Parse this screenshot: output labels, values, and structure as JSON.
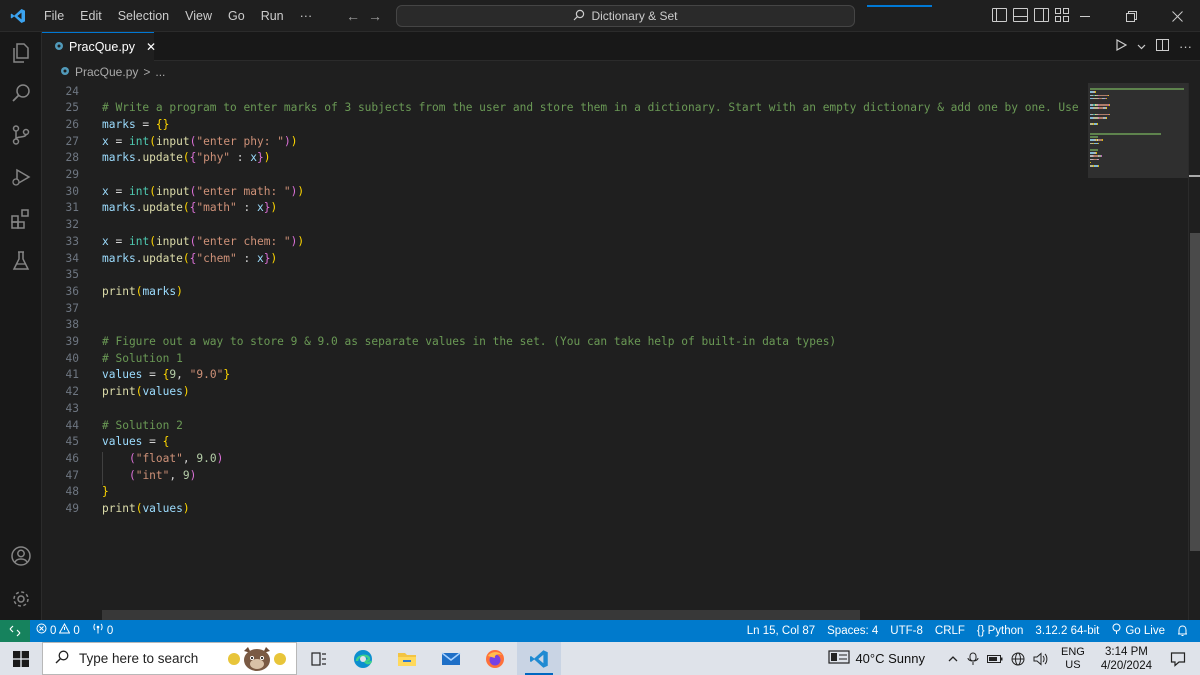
{
  "titlebar": {
    "menu": [
      "File",
      "Edit",
      "Selection",
      "View",
      "Go",
      "Run",
      "···"
    ],
    "command_center": "Dictionary & Set",
    "back_glyph": "←",
    "forward_glyph": "→"
  },
  "tab": {
    "filename": "PracQue.py",
    "close_glyph": "✕"
  },
  "breadcrumb": {
    "file": "PracQue.py",
    "separator": ">",
    "rest": "..."
  },
  "editor": {
    "lines": [
      {
        "n": "24",
        "tokens": []
      },
      {
        "n": "25",
        "tokens": [
          {
            "c": "c-com",
            "t": "# Write a program to enter marks of 3 subjects from the user and store them in a dictionary. Start with an empty dictionary & add one by one. Use"
          }
        ]
      },
      {
        "n": "26",
        "tokens": [
          {
            "c": "c-var",
            "t": "marks"
          },
          {
            "c": "c-op",
            "t": " = "
          },
          {
            "c": "c-br",
            "t": "{}"
          }
        ]
      },
      {
        "n": "27",
        "tokens": [
          {
            "c": "c-var",
            "t": "x"
          },
          {
            "c": "c-op",
            "t": " = "
          },
          {
            "c": "c-type",
            "t": "int"
          },
          {
            "c": "c-br",
            "t": "("
          },
          {
            "c": "c-fn",
            "t": "input"
          },
          {
            "c": "c-br2",
            "t": "("
          },
          {
            "c": "c-str",
            "t": "\"enter phy: \""
          },
          {
            "c": "c-br2",
            "t": ")"
          },
          {
            "c": "c-br",
            "t": ")"
          }
        ]
      },
      {
        "n": "28",
        "tokens": [
          {
            "c": "c-var",
            "t": "marks"
          },
          {
            "c": "c-op",
            "t": "."
          },
          {
            "c": "c-fn",
            "t": "update"
          },
          {
            "c": "c-br",
            "t": "("
          },
          {
            "c": "c-br2",
            "t": "{"
          },
          {
            "c": "c-str",
            "t": "\"phy\""
          },
          {
            "c": "c-op",
            "t": " : "
          },
          {
            "c": "c-var",
            "t": "x"
          },
          {
            "c": "c-br2",
            "t": "}"
          },
          {
            "c": "c-br",
            "t": ")"
          }
        ]
      },
      {
        "n": "29",
        "tokens": []
      },
      {
        "n": "30",
        "tokens": [
          {
            "c": "c-var",
            "t": "x"
          },
          {
            "c": "c-op",
            "t": " = "
          },
          {
            "c": "c-type",
            "t": "int"
          },
          {
            "c": "c-br",
            "t": "("
          },
          {
            "c": "c-fn",
            "t": "input"
          },
          {
            "c": "c-br2",
            "t": "("
          },
          {
            "c": "c-str",
            "t": "\"enter math: \""
          },
          {
            "c": "c-br2",
            "t": ")"
          },
          {
            "c": "c-br",
            "t": ")"
          }
        ]
      },
      {
        "n": "31",
        "tokens": [
          {
            "c": "c-var",
            "t": "marks"
          },
          {
            "c": "c-op",
            "t": "."
          },
          {
            "c": "c-fn",
            "t": "update"
          },
          {
            "c": "c-br",
            "t": "("
          },
          {
            "c": "c-br2",
            "t": "{"
          },
          {
            "c": "c-str",
            "t": "\"math\""
          },
          {
            "c": "c-op",
            "t": " : "
          },
          {
            "c": "c-var",
            "t": "x"
          },
          {
            "c": "c-br2",
            "t": "}"
          },
          {
            "c": "c-br",
            "t": ")"
          }
        ]
      },
      {
        "n": "32",
        "tokens": []
      },
      {
        "n": "33",
        "tokens": [
          {
            "c": "c-var",
            "t": "x"
          },
          {
            "c": "c-op",
            "t": " = "
          },
          {
            "c": "c-type",
            "t": "int"
          },
          {
            "c": "c-br",
            "t": "("
          },
          {
            "c": "c-fn",
            "t": "input"
          },
          {
            "c": "c-br2",
            "t": "("
          },
          {
            "c": "c-str",
            "t": "\"enter chem: \""
          },
          {
            "c": "c-br2",
            "t": ")"
          },
          {
            "c": "c-br",
            "t": ")"
          }
        ]
      },
      {
        "n": "34",
        "tokens": [
          {
            "c": "c-var",
            "t": "marks"
          },
          {
            "c": "c-op",
            "t": "."
          },
          {
            "c": "c-fn",
            "t": "update"
          },
          {
            "c": "c-br",
            "t": "("
          },
          {
            "c": "c-br2",
            "t": "{"
          },
          {
            "c": "c-str",
            "t": "\"chem\""
          },
          {
            "c": "c-op",
            "t": " : "
          },
          {
            "c": "c-var",
            "t": "x"
          },
          {
            "c": "c-br2",
            "t": "}"
          },
          {
            "c": "c-br",
            "t": ")"
          }
        ]
      },
      {
        "n": "35",
        "tokens": []
      },
      {
        "n": "36",
        "tokens": [
          {
            "c": "c-fn",
            "t": "print"
          },
          {
            "c": "c-br",
            "t": "("
          },
          {
            "c": "c-var",
            "t": "marks"
          },
          {
            "c": "c-br",
            "t": ")"
          }
        ]
      },
      {
        "n": "37",
        "tokens": []
      },
      {
        "n": "38",
        "tokens": []
      },
      {
        "n": "39",
        "tokens": [
          {
            "c": "c-com",
            "t": "# Figure out a way to store 9 & 9.0 as separate values in the set. (You can take help of built-in data types)"
          }
        ]
      },
      {
        "n": "40",
        "tokens": [
          {
            "c": "c-com",
            "t": "# Solution 1"
          }
        ]
      },
      {
        "n": "41",
        "tokens": [
          {
            "c": "c-var",
            "t": "values"
          },
          {
            "c": "c-op",
            "t": " = "
          },
          {
            "c": "c-br",
            "t": "{"
          },
          {
            "c": "c-num",
            "t": "9"
          },
          {
            "c": "c-op",
            "t": ", "
          },
          {
            "c": "c-str",
            "t": "\"9.0\""
          },
          {
            "c": "c-br",
            "t": "}"
          }
        ]
      },
      {
        "n": "42",
        "tokens": [
          {
            "c": "c-fn",
            "t": "print"
          },
          {
            "c": "c-br",
            "t": "("
          },
          {
            "c": "c-var",
            "t": "values"
          },
          {
            "c": "c-br",
            "t": ")"
          }
        ]
      },
      {
        "n": "43",
        "tokens": []
      },
      {
        "n": "44",
        "tokens": [
          {
            "c": "c-com",
            "t": "# Solution 2"
          }
        ]
      },
      {
        "n": "45",
        "tokens": [
          {
            "c": "c-var",
            "t": "values"
          },
          {
            "c": "c-op",
            "t": " = "
          },
          {
            "c": "c-br",
            "t": "{"
          }
        ]
      },
      {
        "n": "46",
        "tokens": [
          {
            "c": "c-op",
            "t": "    "
          },
          {
            "c": "c-br2",
            "t": "("
          },
          {
            "c": "c-str",
            "t": "\"float\""
          },
          {
            "c": "c-op",
            "t": ", "
          },
          {
            "c": "c-num",
            "t": "9.0"
          },
          {
            "c": "c-br2",
            "t": ")"
          }
        ]
      },
      {
        "n": "47",
        "tokens": [
          {
            "c": "c-op",
            "t": "    "
          },
          {
            "c": "c-br2",
            "t": "("
          },
          {
            "c": "c-str",
            "t": "\"int\""
          },
          {
            "c": "c-op",
            "t": ", "
          },
          {
            "c": "c-num",
            "t": "9"
          },
          {
            "c": "c-br2",
            "t": ")"
          }
        ]
      },
      {
        "n": "48",
        "tokens": [
          {
            "c": "c-br",
            "t": "}"
          }
        ]
      },
      {
        "n": "49",
        "tokens": [
          {
            "c": "c-fn",
            "t": "print"
          },
          {
            "c": "c-br",
            "t": "("
          },
          {
            "c": "c-var",
            "t": "values"
          },
          {
            "c": "c-br",
            "t": ")"
          }
        ]
      }
    ]
  },
  "statusbar": {
    "errors": "0",
    "warnings": "0",
    "ports": "0",
    "cursor": "Ln 15, Col 87",
    "spaces": "Spaces: 4",
    "encoding": "UTF-8",
    "eol": "CRLF",
    "language": "Python",
    "interpreter": "3.12.2 64-bit",
    "go_live": "Go Live"
  },
  "taskbar": {
    "search_placeholder": "Type here to search",
    "weather": "40°C  Sunny",
    "lang_top": "ENG",
    "lang_bottom": "US",
    "time": "3:14 PM",
    "date": "4/20/2024"
  },
  "colors": {
    "accent": "#007acc",
    "editor_bg": "#1f1f1f",
    "python_icon": "#519aba"
  }
}
